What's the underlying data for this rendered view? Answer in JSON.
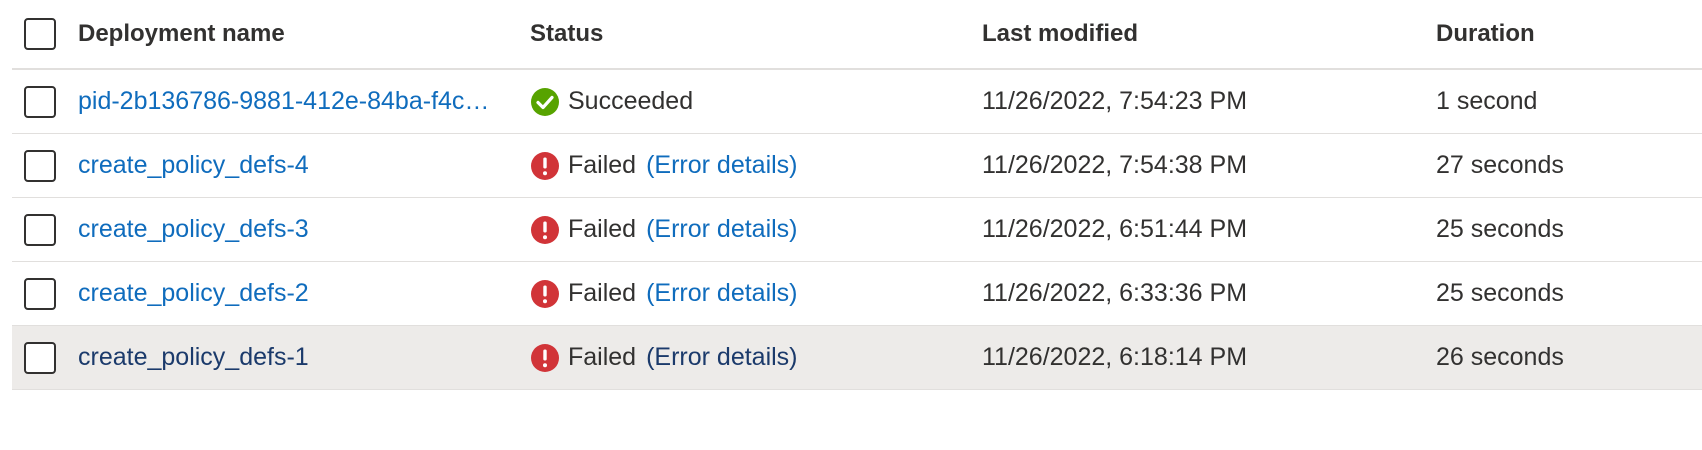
{
  "columns": {
    "name": "Deployment name",
    "status": "Status",
    "last_modified": "Last modified",
    "duration": "Duration"
  },
  "rows": [
    {
      "name": "pid-2b136786-9881-412e-84ba-f4c…",
      "status": "Succeeded",
      "error_link": "",
      "last_modified": "11/26/2022, 7:54:23 PM",
      "duration": "1 second",
      "status_icon": "success-check-icon"
    },
    {
      "name": "create_policy_defs-4",
      "status": "Failed",
      "error_link": "(Error details)",
      "last_modified": "11/26/2022, 7:54:38 PM",
      "duration": "27 seconds",
      "status_icon": "error-exclamation-icon"
    },
    {
      "name": "create_policy_defs-3",
      "status": "Failed",
      "error_link": "(Error details)",
      "last_modified": "11/26/2022, 6:51:44 PM",
      "duration": "25 seconds",
      "status_icon": "error-exclamation-icon"
    },
    {
      "name": "create_policy_defs-2",
      "status": "Failed",
      "error_link": "(Error details)",
      "last_modified": "11/26/2022, 6:33:36 PM",
      "duration": "25 seconds",
      "status_icon": "error-exclamation-icon"
    },
    {
      "name": "create_policy_defs-1",
      "status": "Failed",
      "error_link": "(Error details)",
      "last_modified": "11/26/2022, 6:18:14 PM",
      "duration": "26 seconds",
      "status_icon": "error-exclamation-icon"
    }
  ],
  "colors": {
    "link": "#0f6cbd",
    "success": "#57a300",
    "error": "#d13438",
    "selected_row": "#edebe9"
  }
}
